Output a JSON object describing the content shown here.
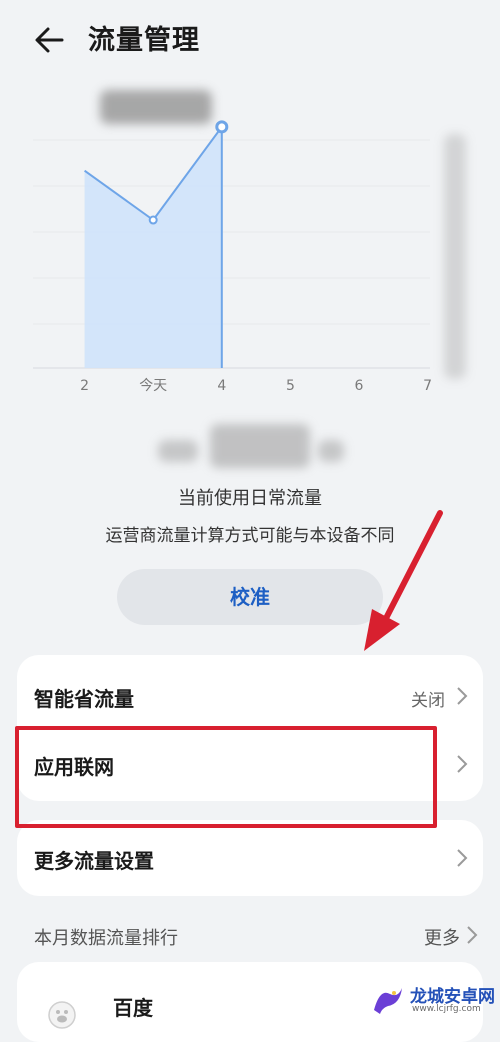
{
  "header": {
    "title": "流量管理"
  },
  "chart_data": {
    "type": "line",
    "x_labels": [
      "2",
      "今天",
      "4",
      "5",
      "6",
      "7"
    ],
    "series": [
      {
        "x": [
          1,
          2,
          3
        ],
        "values": [
          0.72,
          0.54,
          0.88
        ]
      }
    ],
    "ylim": [
      0,
      1
    ],
    "colors": {
      "line": "#6ea5e8",
      "fill": "#cfe3fb",
      "grid": "#e6e8eb"
    }
  },
  "usage": {
    "label": "当前使用日常流量",
    "note": "运营商流量计算方式可能与本设备不同"
  },
  "calibrate_label": "校准",
  "settings": {
    "smart_save": {
      "label": "智能省流量",
      "value": "关闭"
    },
    "app_network": {
      "label": "应用联网"
    },
    "more_settings": {
      "label": "更多流量设置"
    }
  },
  "ranking": {
    "title": "本月数据流量排行",
    "more": "更多",
    "items": [
      {
        "name": "百度"
      }
    ]
  },
  "watermark": {
    "text": "龙城安卓网",
    "url": "www.lcjrfg.com"
  },
  "colors": {
    "accent": "#1d5fc4",
    "highlight": "#d8202f",
    "arrow": "#d8202f"
  }
}
